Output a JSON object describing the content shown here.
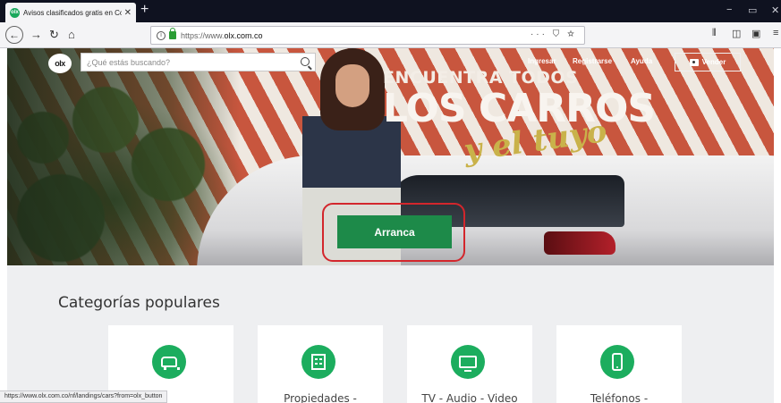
{
  "browser": {
    "tab_title": "Avisos clasificados gratis en Co",
    "tab_favicon_text": "olx",
    "new_tab_label": "+",
    "window_controls": [
      "−",
      "▭",
      "✕"
    ],
    "url_prefix": "https://www.",
    "url_domain": "olx.com.co",
    "url_tools": "··· ⛉ ☆",
    "toolbar_icons": [
      "library-icon",
      "sidebar-icon",
      "screenshot-icon",
      "menu-icon"
    ]
  },
  "hero": {
    "logo_text": "olx",
    "search_placeholder": "¿Qué estás buscando?",
    "nav": {
      "login": "Ingresar",
      "register": "Registrarse",
      "help": "Ayuda"
    },
    "sell_label": "Vender",
    "headline_small": "ENCUENTRA TODOS",
    "headline_big": "LOS CARROS",
    "headline_script": "y el tuyo",
    "cta_label": "Arranca"
  },
  "categories": {
    "title": "Categorías populares",
    "items": [
      {
        "label": "",
        "icon": "car-icon"
      },
      {
        "label": "Propiedades -",
        "icon": "building-icon"
      },
      {
        "label": "TV - Audio - Video",
        "icon": "tv-icon"
      },
      {
        "label": "Teléfonos -",
        "icon": "phone-icon"
      }
    ]
  },
  "status_bar": {
    "link_preview": "https://www.olx.com.co/nf/landings/cars?from=olx_button"
  },
  "colors": {
    "brand_green": "#1d8a49",
    "category_icon_green": "#1cad5e",
    "highlight_red": "#d3262c"
  }
}
